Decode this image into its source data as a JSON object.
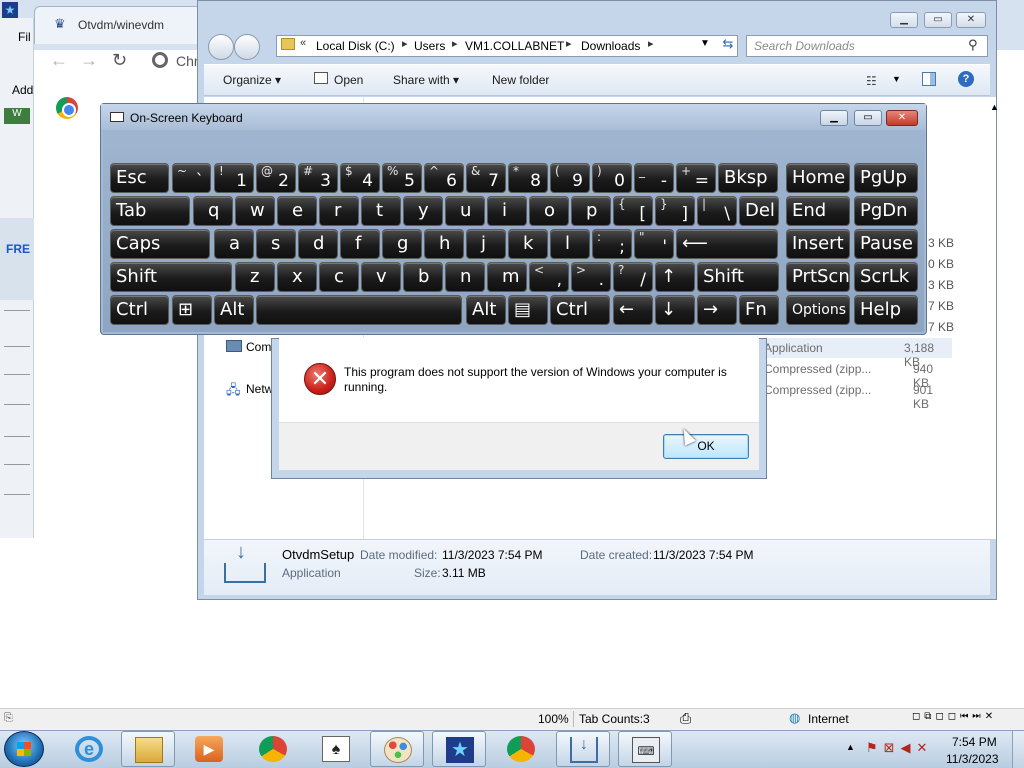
{
  "ie": {
    "tab_title": "Otvdm/winevdm",
    "menu_fragment": "Fil",
    "address_fragment": "Chr",
    "add_fragment": "Add",
    "w_badge": "W",
    "left_fre": "FRE",
    "status": {
      "zoom": "100%",
      "tab_counts": "Tab Counts:3",
      "zone": "Internet"
    }
  },
  "explorer": {
    "breadcrumbs": [
      "Local Disk (C:)",
      "Users",
      "VM1.COLLABNET",
      "Downloads"
    ],
    "crumb_overflow": "«",
    "search_placeholder": "Search Downloads",
    "commands": {
      "organize": "Organize",
      "open": "Open",
      "share_with": "Share with",
      "new_folder": "New folder"
    },
    "nav": {
      "computer": "Com",
      "network": "Netw"
    },
    "size_fragments": [
      "3 KB",
      "0 KB",
      "3 KB",
      "7 KB",
      "7 KB"
    ],
    "files": [
      {
        "type": "Application",
        "size": "3,188 KB"
      },
      {
        "type": "Compressed (zipp...",
        "size": "940 KB"
      },
      {
        "type": "Compressed (zipp...",
        "size": "901 KB"
      }
    ],
    "details": {
      "name": "OtvdmSetup",
      "type": "Application",
      "modified_label": "Date modified:",
      "modified_value": "11/3/2023 7:54 PM",
      "created_label": "Date created:",
      "created_value": "11/3/2023 7:54 PM",
      "size_label": "Size:",
      "size_value": "3.11 MB"
    }
  },
  "osk": {
    "title": "On-Screen Keyboard",
    "rows": [
      [
        {
          "main": "Esc"
        },
        {
          "shift": "~",
          "base": "`"
        },
        {
          "shift": "!",
          "base": "1"
        },
        {
          "shift": "@",
          "base": "2"
        },
        {
          "shift": "#",
          "base": "3"
        },
        {
          "shift": "$",
          "base": "4"
        },
        {
          "shift": "%",
          "base": "5"
        },
        {
          "shift": "^",
          "base": "6"
        },
        {
          "shift": "&",
          "base": "7"
        },
        {
          "shift": "*",
          "base": "8"
        },
        {
          "shift": "(",
          "base": "9"
        },
        {
          "shift": ")",
          "base": "0"
        },
        {
          "shift": "_",
          "base": "-"
        },
        {
          "shift": "+",
          "base": "="
        },
        {
          "main": "Bksp"
        },
        {
          "main": "Home"
        },
        {
          "main": "PgUp"
        }
      ],
      [
        {
          "main": "Tab"
        },
        {
          "main": "q"
        },
        {
          "main": "w"
        },
        {
          "main": "e"
        },
        {
          "main": "r"
        },
        {
          "main": "t"
        },
        {
          "main": "y"
        },
        {
          "main": "u"
        },
        {
          "main": "i"
        },
        {
          "main": "o"
        },
        {
          "main": "p"
        },
        {
          "shift": "{",
          "base": "["
        },
        {
          "shift": "}",
          "base": "]"
        },
        {
          "shift": "|",
          "base": "\\"
        },
        {
          "main": "Del"
        },
        {
          "main": "End"
        },
        {
          "main": "PgDn"
        }
      ],
      [
        {
          "main": "Caps"
        },
        {
          "main": "a"
        },
        {
          "main": "s"
        },
        {
          "main": "d"
        },
        {
          "main": "f"
        },
        {
          "main": "g"
        },
        {
          "main": "h"
        },
        {
          "main": "j"
        },
        {
          "main": "k"
        },
        {
          "main": "l"
        },
        {
          "shift": ":",
          "base": ";"
        },
        {
          "shift": "\"",
          "base": "'"
        },
        {
          "main": "⟵"
        },
        {
          "main": "Insert"
        },
        {
          "main": "Pause"
        }
      ],
      [
        {
          "main": "Shift"
        },
        {
          "main": "z"
        },
        {
          "main": "x"
        },
        {
          "main": "c"
        },
        {
          "main": "v"
        },
        {
          "main": "b"
        },
        {
          "main": "n"
        },
        {
          "main": "m"
        },
        {
          "shift": "<",
          "base": ","
        },
        {
          "shift": ">",
          "base": "."
        },
        {
          "shift": "?",
          "base": "/"
        },
        {
          "main": "↑"
        },
        {
          "main": "Shift"
        },
        {
          "main": "PrtScn"
        },
        {
          "main": "ScrLk"
        }
      ],
      [
        {
          "main": "Ctrl"
        },
        {
          "main": "⊞"
        },
        {
          "main": "Alt"
        },
        {
          "main": ""
        },
        {
          "main": "Alt"
        },
        {
          "main": "▤"
        },
        {
          "main": "Ctrl"
        },
        {
          "main": "←"
        },
        {
          "main": "↓"
        },
        {
          "main": "→"
        },
        {
          "main": "Fn"
        },
        {
          "main": "Options"
        },
        {
          "main": "Help"
        }
      ]
    ]
  },
  "dialog": {
    "message": "This program does not support the version of Windows your computer is running.",
    "ok_label": "OK"
  },
  "taskbar": {
    "clock_time": "7:54 PM",
    "clock_date": "11/3/2023"
  }
}
